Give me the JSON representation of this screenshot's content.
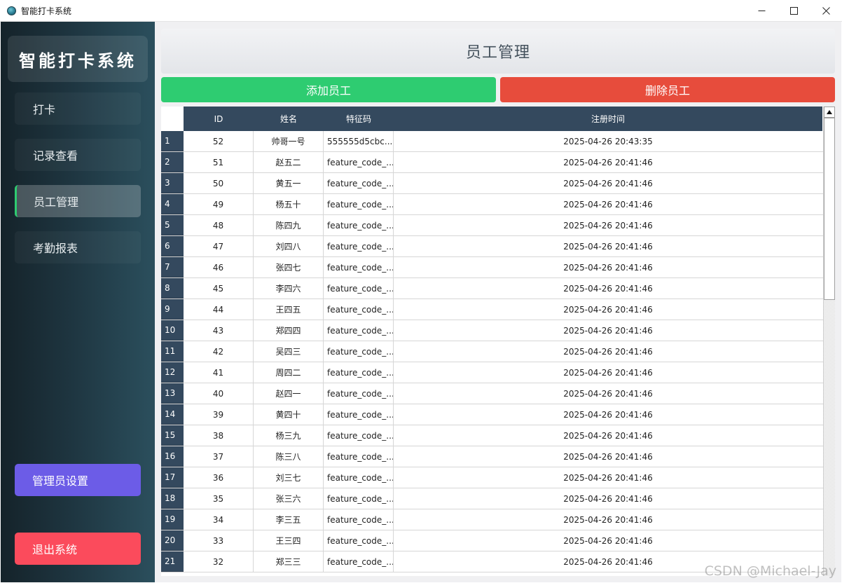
{
  "window": {
    "title": "智能打卡系统"
  },
  "sidebar": {
    "brand": "智能打卡系统",
    "items": [
      {
        "label": "打卡",
        "active": false
      },
      {
        "label": "记录查看",
        "active": false
      },
      {
        "label": "员工管理",
        "active": true
      },
      {
        "label": "考勤报表",
        "active": false
      }
    ],
    "admin_label": "管理员设置",
    "exit_label": "退出系统"
  },
  "main": {
    "title": "员工管理",
    "add_label": "添加员工",
    "delete_label": "删除员工"
  },
  "table": {
    "columns": [
      "ID",
      "姓名",
      "特征码",
      "注册时间"
    ],
    "rows": [
      {
        "n": "1",
        "id": "52",
        "name": "帅哥一号",
        "code": "555555d5cbc...",
        "time": "2025-04-26 20:43:35"
      },
      {
        "n": "2",
        "id": "51",
        "name": "赵五二",
        "code": "feature_code_...",
        "time": "2025-04-26 20:41:46"
      },
      {
        "n": "3",
        "id": "50",
        "name": "黄五一",
        "code": "feature_code_...",
        "time": "2025-04-26 20:41:46"
      },
      {
        "n": "4",
        "id": "49",
        "name": "杨五十",
        "code": "feature_code_...",
        "time": "2025-04-26 20:41:46"
      },
      {
        "n": "5",
        "id": "48",
        "name": "陈四九",
        "code": "feature_code_...",
        "time": "2025-04-26 20:41:46"
      },
      {
        "n": "6",
        "id": "47",
        "name": "刘四八",
        "code": "feature_code_...",
        "time": "2025-04-26 20:41:46"
      },
      {
        "n": "7",
        "id": "46",
        "name": "张四七",
        "code": "feature_code_...",
        "time": "2025-04-26 20:41:46"
      },
      {
        "n": "8",
        "id": "45",
        "name": "李四六",
        "code": "feature_code_...",
        "time": "2025-04-26 20:41:46"
      },
      {
        "n": "9",
        "id": "44",
        "name": "王四五",
        "code": "feature_code_...",
        "time": "2025-04-26 20:41:46"
      },
      {
        "n": "10",
        "id": "43",
        "name": "郑四四",
        "code": "feature_code_...",
        "time": "2025-04-26 20:41:46"
      },
      {
        "n": "11",
        "id": "42",
        "name": "吴四三",
        "code": "feature_code_...",
        "time": "2025-04-26 20:41:46"
      },
      {
        "n": "12",
        "id": "41",
        "name": "周四二",
        "code": "feature_code_...",
        "time": "2025-04-26 20:41:46"
      },
      {
        "n": "13",
        "id": "40",
        "name": "赵四一",
        "code": "feature_code_...",
        "time": "2025-04-26 20:41:46"
      },
      {
        "n": "14",
        "id": "39",
        "name": "黄四十",
        "code": "feature_code_...",
        "time": "2025-04-26 20:41:46"
      },
      {
        "n": "15",
        "id": "38",
        "name": "杨三九",
        "code": "feature_code_...",
        "time": "2025-04-26 20:41:46"
      },
      {
        "n": "16",
        "id": "37",
        "name": "陈三八",
        "code": "feature_code_...",
        "time": "2025-04-26 20:41:46"
      },
      {
        "n": "17",
        "id": "36",
        "name": "刘三七",
        "code": "feature_code_...",
        "time": "2025-04-26 20:41:46"
      },
      {
        "n": "18",
        "id": "35",
        "name": "张三六",
        "code": "feature_code_...",
        "time": "2025-04-26 20:41:46"
      },
      {
        "n": "19",
        "id": "34",
        "name": "李三五",
        "code": "feature_code_...",
        "time": "2025-04-26 20:41:46"
      },
      {
        "n": "20",
        "id": "33",
        "name": "王三四",
        "code": "feature_code_...",
        "time": "2025-04-26 20:41:46"
      },
      {
        "n": "21",
        "id": "32",
        "name": "郑三三",
        "code": "feature_code_...",
        "time": "2025-04-26 20:41:46"
      }
    ]
  },
  "watermark": "CSDN @Michael-Jay",
  "colors": {
    "add": "#2ecc71",
    "delete": "#e74c3c",
    "admin": "#6c5ce7",
    "exit": "#fb4b5c",
    "table_header": "#34495e",
    "active_indicator": "#2ecc71"
  }
}
